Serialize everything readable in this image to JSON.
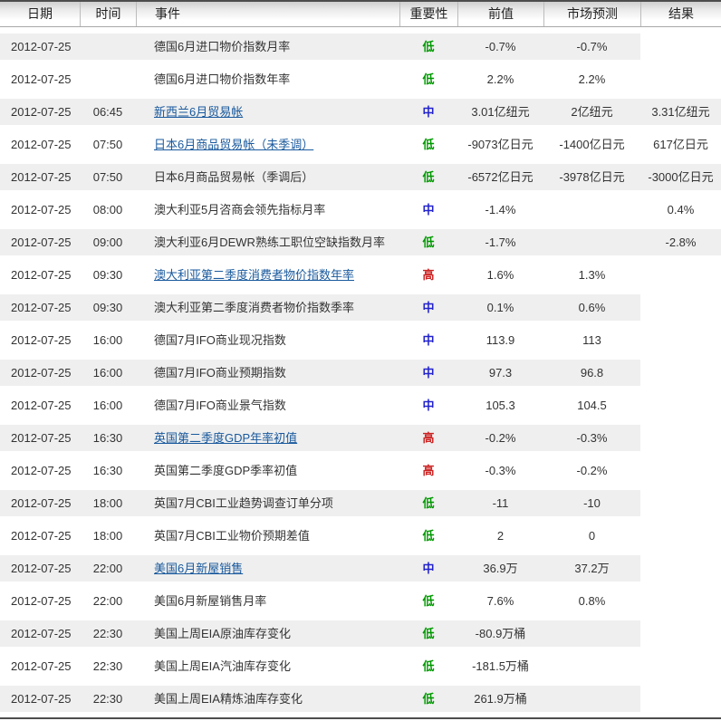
{
  "colors": {
    "row_stripe": "#efefef",
    "link": "#19599d",
    "importance_low": "#009900",
    "importance_mid": "#2222cc",
    "importance_high": "#cc2222",
    "table_border": "#4d4d4d",
    "header_underline": "#a9a9a9"
  },
  "table": {
    "columns": [
      {
        "key": "date",
        "label": "日期"
      },
      {
        "key": "time",
        "label": "时间"
      },
      {
        "key": "event",
        "label": "事件"
      },
      {
        "key": "importance",
        "label": "重要性"
      },
      {
        "key": "previous",
        "label": "前值"
      },
      {
        "key": "forecast",
        "label": "市场预测"
      },
      {
        "key": "result",
        "label": "结果"
      }
    ],
    "importance_legend": {
      "low": "低",
      "mid": "中",
      "high": "高"
    },
    "rows": [
      {
        "date": "2012-07-25",
        "time": "",
        "event": "德国6月进口物价指数月率",
        "link": false,
        "importance": "低",
        "level": "low",
        "previous": "-0.7%",
        "forecast": "-0.7%",
        "result": "",
        "striped": true
      },
      {
        "date": "2012-07-25",
        "time": "",
        "event": "德国6月进口物价指数年率",
        "link": false,
        "importance": "低",
        "level": "low",
        "previous": "2.2%",
        "forecast": "2.2%",
        "result": "",
        "striped": false
      },
      {
        "date": "2012-07-25",
        "time": "06:45",
        "event": "新西兰6月贸易帐",
        "link": true,
        "importance": "中",
        "level": "mid",
        "previous": "3.01亿纽元",
        "forecast": "2亿纽元",
        "result": "3.31亿纽元",
        "striped": true
      },
      {
        "date": "2012-07-25",
        "time": "07:50",
        "event": "日本6月商品贸易帐（未季调）",
        "link": true,
        "importance": "低",
        "level": "low",
        "previous": "-9073亿日元",
        "forecast": "-1400亿日元",
        "result": "617亿日元",
        "striped": false
      },
      {
        "date": "2012-07-25",
        "time": "07:50",
        "event": "日本6月商品贸易帐（季调后）",
        "link": false,
        "importance": "低",
        "level": "low",
        "previous": "-6572亿日元",
        "forecast": "-3978亿日元",
        "result": "-3000亿日元",
        "striped": true
      },
      {
        "date": "2012-07-25",
        "time": "08:00",
        "event": "澳大利亚5月咨商会领先指标月率",
        "link": false,
        "importance": "中",
        "level": "mid",
        "previous": "-1.4%",
        "forecast": "",
        "result": "0.4%",
        "striped": false
      },
      {
        "date": "2012-07-25",
        "time": "09:00",
        "event": "澳大利亚6月DEWR熟练工职位空缺指数月率",
        "link": false,
        "importance": "低",
        "level": "low",
        "previous": "-1.7%",
        "forecast": "",
        "result": "-2.8%",
        "striped": true
      },
      {
        "date": "2012-07-25",
        "time": "09:30",
        "event": "澳大利亚第二季度消费者物价指数年率",
        "link": true,
        "importance": "高",
        "level": "high",
        "previous": "1.6%",
        "forecast": "1.3%",
        "result": "",
        "striped": false
      },
      {
        "date": "2012-07-25",
        "time": "09:30",
        "event": "澳大利亚第二季度消费者物价指数季率",
        "link": false,
        "importance": "中",
        "level": "mid",
        "previous": "0.1%",
        "forecast": "0.6%",
        "result": "",
        "striped": true
      },
      {
        "date": "2012-07-25",
        "time": "16:00",
        "event": "德国7月IFO商业现况指数",
        "link": false,
        "importance": "中",
        "level": "mid",
        "previous": "113.9",
        "forecast": "113",
        "result": "",
        "striped": false
      },
      {
        "date": "2012-07-25",
        "time": "16:00",
        "event": "德国7月IFO商业预期指数",
        "link": false,
        "importance": "中",
        "level": "mid",
        "previous": "97.3",
        "forecast": "96.8",
        "result": "",
        "striped": true
      },
      {
        "date": "2012-07-25",
        "time": "16:00",
        "event": "德国7月IFO商业景气指数",
        "link": false,
        "importance": "中",
        "level": "mid",
        "previous": "105.3",
        "forecast": "104.5",
        "result": "",
        "striped": false
      },
      {
        "date": "2012-07-25",
        "time": "16:30",
        "event": "英国第二季度GDP年率初值",
        "link": true,
        "importance": "高",
        "level": "high",
        "previous": "-0.2%",
        "forecast": "-0.3%",
        "result": "",
        "striped": true
      },
      {
        "date": "2012-07-25",
        "time": "16:30",
        "event": "英国第二季度GDP季率初值",
        "link": false,
        "importance": "高",
        "level": "high",
        "previous": "-0.3%",
        "forecast": "-0.2%",
        "result": "",
        "striped": false
      },
      {
        "date": "2012-07-25",
        "time": "18:00",
        "event": "英国7月CBI工业趋势调查订单分项",
        "link": false,
        "importance": "低",
        "level": "low",
        "previous": "-11",
        "forecast": "-10",
        "result": "",
        "striped": true
      },
      {
        "date": "2012-07-25",
        "time": "18:00",
        "event": "英国7月CBI工业物价预期差值",
        "link": false,
        "importance": "低",
        "level": "low",
        "previous": "2",
        "forecast": "0",
        "result": "",
        "striped": false
      },
      {
        "date": "2012-07-25",
        "time": "22:00",
        "event": "美国6月新屋销售",
        "link": true,
        "importance": "中",
        "level": "mid",
        "previous": "36.9万",
        "forecast": "37.2万",
        "result": "",
        "striped": true
      },
      {
        "date": "2012-07-25",
        "time": "22:00",
        "event": "美国6月新屋销售月率",
        "link": false,
        "importance": "低",
        "level": "low",
        "previous": "7.6%",
        "forecast": "0.8%",
        "result": "",
        "striped": false
      },
      {
        "date": "2012-07-25",
        "time": "22:30",
        "event": "美国上周EIA原油库存变化",
        "link": false,
        "importance": "低",
        "level": "low",
        "previous": "-80.9万桶",
        "forecast": "",
        "result": "",
        "striped": true
      },
      {
        "date": "2012-07-25",
        "time": "22:30",
        "event": "美国上周EIA汽油库存变化",
        "link": false,
        "importance": "低",
        "level": "low",
        "previous": "-181.5万桶",
        "forecast": "",
        "result": "",
        "striped": false
      },
      {
        "date": "2012-07-25",
        "time": "22:30",
        "event": "美国上周EIA精炼油库存变化",
        "link": false,
        "importance": "低",
        "level": "low",
        "previous": "261.9万桶",
        "forecast": "",
        "result": "",
        "striped": true
      }
    ]
  }
}
